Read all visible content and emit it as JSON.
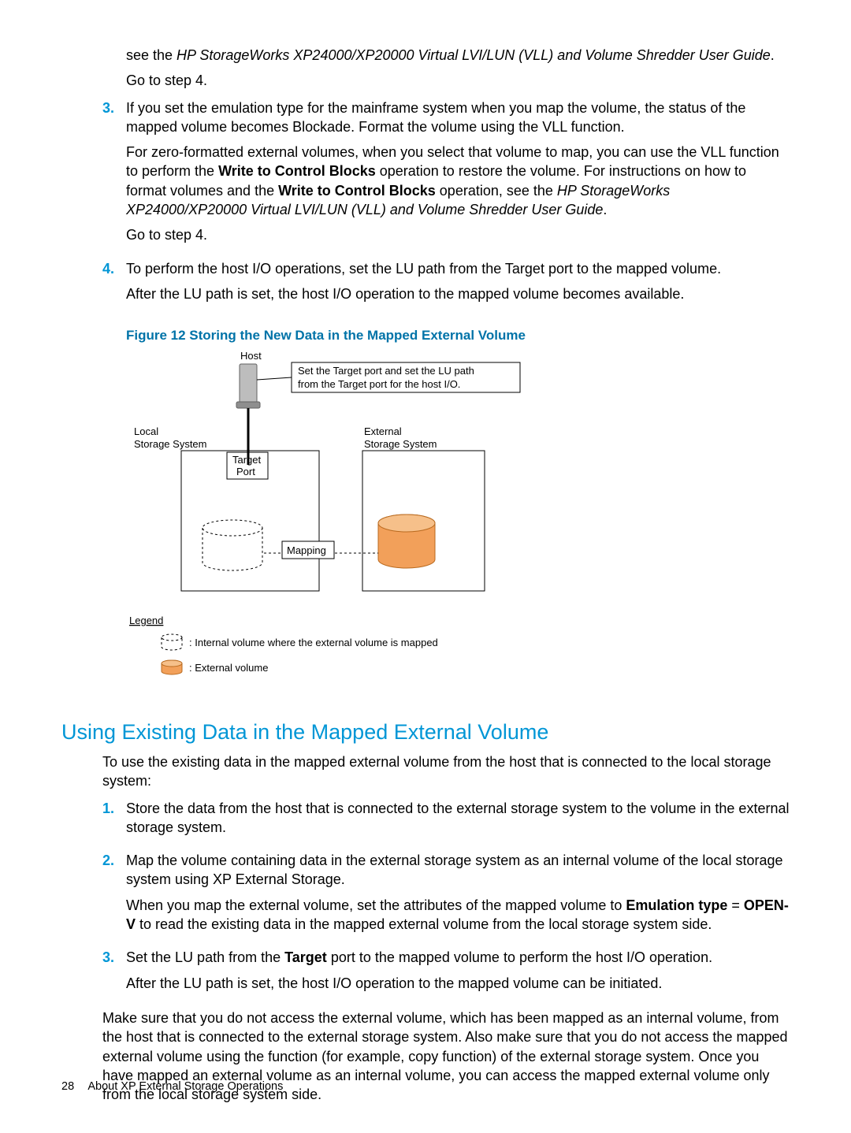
{
  "intro": {
    "line1_pre": "see the ",
    "line1_italic": "HP StorageWorks XP24000/XP20000 Virtual LVI/LUN (VLL) and Volume Shredder User Guide",
    "line1_post": ".",
    "line2": "Go to step 4."
  },
  "list1": {
    "item3": {
      "num": "3.",
      "p1": "If you set the emulation type for the mainframe system when you map the volume, the status of the mapped volume becomes Blockade. Format the volume using the VLL function.",
      "p2_a": "For zero-formatted external volumes, when you select that volume to map, you can use the VLL function to perform the ",
      "p2_b": "Write to Control Blocks",
      "p2_c": " operation to restore the volume. For instructions on how to format volumes and the ",
      "p2_d": "Write to Control Blocks",
      "p2_e": " operation, see the ",
      "p2_f": "HP StorageWorks XP24000/XP20000 Virtual LVI/LUN (VLL) and Volume Shredder User Guide",
      "p2_g": ".",
      "p3": "Go to step 4."
    },
    "item4": {
      "num": "4.",
      "p1": "To perform the host I/O operations, set the LU path from the Target port to the mapped volume.",
      "p2": "After the LU path is set, the host I/O operation to the mapped volume becomes available."
    }
  },
  "figure_caption": "Figure 12 Storing the New Data in the Mapped External Volume",
  "diagram": {
    "host": "Host",
    "callout1": "Set the Target port and set the LU path",
    "callout2": "from the Target port for the host I/O.",
    "local": "Local",
    "storage_system": "Storage System",
    "target": "Target",
    "port": "Port",
    "external": "External",
    "ext_storage_system": "Storage System",
    "mapping": "Mapping",
    "legend": "Legend",
    "legend_internal": ": Internal volume where the external volume is mapped",
    "legend_external": ": External volume"
  },
  "section_heading": "Using Existing Data in the Mapped External Volume",
  "section_intro": "To use the existing data in the mapped external volume from the host that is connected to the local storage system:",
  "list2": {
    "item1": {
      "num": "1.",
      "p1": "Store the data from the host that is connected to the external storage system to the volume in the external storage system."
    },
    "item2": {
      "num": "2.",
      "p1": "Map the volume containing data in the external storage system as an internal volume of the local storage system using XP External Storage.",
      "p2_a": "When you map the external volume, set the attributes of the mapped volume to ",
      "p2_b": "Emulation type",
      "p2_c": " = ",
      "p2_d": "OPEN-V",
      "p2_e": " to read the existing data in the mapped external volume from the local storage system side."
    },
    "item3": {
      "num": "3.",
      "p1_a": "Set the LU path from the ",
      "p1_b": "Target",
      "p1_c": " port to the mapped volume to perform the host I/O operation.",
      "p2": "After the LU path is set, the host I/O operation to the mapped volume can be initiated."
    }
  },
  "closing": "Make sure that you do not access the external volume, which has been mapped as an internal volume, from the host that is connected to the external storage system. Also make sure that you do not access the mapped external volume using the function (for example, copy function) of the external storage system. Once you have mapped an external volume as an internal volume, you can access the mapped external volume only from the local storage system side.",
  "footer": {
    "page": "28",
    "title": "About XP External Storage Operations"
  }
}
